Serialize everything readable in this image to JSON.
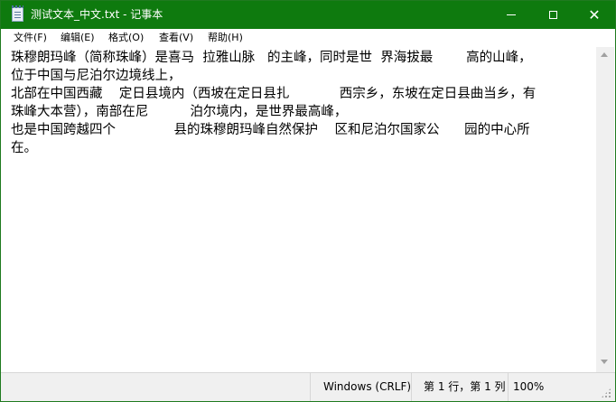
{
  "window": {
    "title": "测试文本_中文.txt - 记事本",
    "accent_color": "#0e7a0e",
    "controls": {
      "minimize_icon": "minimize-icon",
      "maximize_icon": "maximize-icon",
      "close_icon": "close-icon",
      "close_glyph": "✕"
    }
  },
  "menu": {
    "items": [
      "文件(F)",
      "编辑(E)",
      "格式(O)",
      "查看(V)",
      "帮助(H)"
    ]
  },
  "document": {
    "lines": [
      "珠穆朗玛峰（简称珠峰）是喜马  拉雅山脉   的主峰，同时是世  界海拔最        高的山峰，",
      "位于中国与尼泊尔边境线上，",
      "北部在中国西藏    定日县境内（西坡在定日县扎            西宗乡，东坡在定日县曲当乡，有",
      "珠峰大本营），南部在尼          泊尔境内，是世界最高峰，",
      "也是中国跨越四个              县的珠穆朗玛峰自然保护    区和尼泊尔国家公      园的中心所",
      "在。"
    ]
  },
  "status": {
    "line_ending": "Windows (CRLF)",
    "position": "第 1 行，第 1 列",
    "zoom": "100%"
  }
}
